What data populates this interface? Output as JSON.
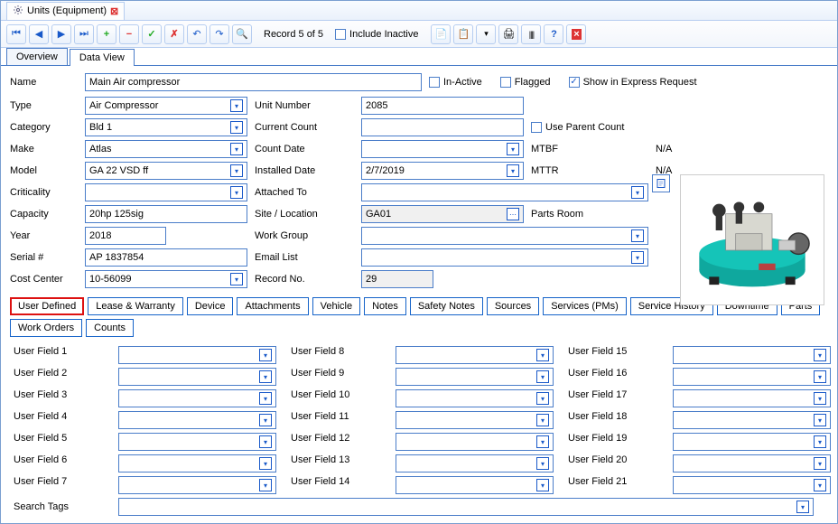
{
  "window": {
    "title": "Units (Equipment)"
  },
  "toolbar": {
    "record_label": "Record 5 of 5",
    "include_inactive_label": "Include Inactive"
  },
  "mainTabs": [
    {
      "label": "Overview",
      "active": false
    },
    {
      "label": "Data View",
      "active": true
    }
  ],
  "form": {
    "name": {
      "label": "Name",
      "value": "Main Air  compressor"
    },
    "inactive_label": "In-Active",
    "flagged_label": "Flagged",
    "show_express_label": "Show in Express Request",
    "type": {
      "label": "Type",
      "value": "Air Compressor"
    },
    "unit_number": {
      "label": "Unit Number",
      "value": "2085"
    },
    "category": {
      "label": "Category",
      "value": "Bld 1"
    },
    "current_count": {
      "label": "Current Count",
      "value": ""
    },
    "use_parent_count_label": "Use Parent Count",
    "make": {
      "label": "Make",
      "value": "Atlas"
    },
    "count_date": {
      "label": "Count Date",
      "value": ""
    },
    "mtbf": {
      "label": "MTBF",
      "value": "N/A"
    },
    "model": {
      "label": "Model",
      "value": "GA 22 VSD ff"
    },
    "installed_date": {
      "label": "Installed Date",
      "value": "2/7/2019"
    },
    "mttr": {
      "label": "MTTR",
      "value": "N/A"
    },
    "criticality": {
      "label": "Criticality",
      "value": ""
    },
    "attached_to": {
      "label": "Attached To",
      "value": ""
    },
    "capacity": {
      "label": "Capacity",
      "value": "20hp 125sig"
    },
    "site_location": {
      "label": "Site / Location",
      "value": "GA01"
    },
    "parts_room": "Parts Room",
    "year": {
      "label": "Year",
      "value": "2018"
    },
    "work_group": {
      "label": "Work Group",
      "value": ""
    },
    "serial": {
      "label": "Serial #",
      "value": "AP 1837854"
    },
    "email_list": {
      "label": "Email List",
      "value": ""
    },
    "cost_center": {
      "label": "Cost Center",
      "value": "10-56099"
    },
    "record_no": {
      "label": "Record No.",
      "value": "29"
    }
  },
  "subTabs": [
    "User Defined",
    "Lease & Warranty",
    "Device",
    "Attachments",
    "Vehicle",
    "Notes",
    "Safety Notes",
    "Sources",
    "Services (PMs)",
    "Service History",
    "Downtime",
    "Parts",
    "Work Orders",
    "Counts"
  ],
  "userFields": {
    "labels": [
      "User Field 1",
      "User Field 2",
      "User Field 3",
      "User Field 4",
      "User Field 5",
      "User Field 6",
      "User Field 7",
      "User Field 8",
      "User Field 9",
      "User Field 10",
      "User Field 11",
      "User Field 12",
      "User Field 13",
      "User Field 14",
      "User Field 15",
      "User Field 16",
      "User Field 17",
      "User Field 18",
      "User Field 19",
      "User Field 20",
      "User Field 21"
    ],
    "search_tags_label": "Search Tags"
  }
}
